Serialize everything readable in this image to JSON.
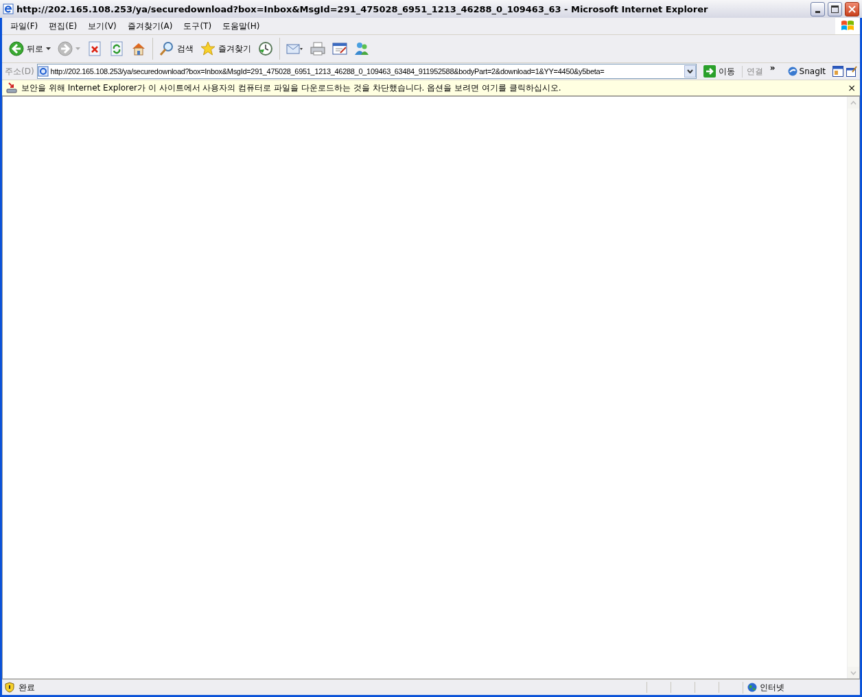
{
  "window": {
    "title": "http://202.165.108.253/ya/securedownload?box=Inbox&MsgId=291_475028_6951_1213_46288_0_109463_63 - Microsoft Internet Explorer"
  },
  "menu": [
    "파일(F)",
    "편집(E)",
    "보기(V)",
    "즐겨찾기(A)",
    "도구(T)",
    "도움말(H)"
  ],
  "toolbar": [
    {
      "kind": "back",
      "label": "뒤로",
      "disabled": false
    },
    {
      "kind": "forward",
      "disabled": true
    },
    {
      "kind": "stop"
    },
    {
      "kind": "refresh"
    },
    {
      "kind": "home"
    },
    {
      "kind": "sep"
    },
    {
      "kind": "search",
      "label": "검색"
    },
    {
      "kind": "favorites",
      "label": "즐겨찾기"
    },
    {
      "kind": "history"
    },
    {
      "kind": "sep"
    },
    {
      "kind": "mail"
    },
    {
      "kind": "print"
    },
    {
      "kind": "edit"
    },
    {
      "kind": "messenger"
    }
  ],
  "address": {
    "label": "주소(D)",
    "value": "http://202.165.108.253/ya/securedownload?box=Inbox&MsgId=291_475028_6951_1213_46288_0_109463_63484_911952588&bodyPart=2&download=1&YY=4450&y5beta=",
    "go": "이동",
    "links": "연결",
    "chevron": "»",
    "snagit": "SnagIt"
  },
  "info_bar": {
    "text": "보안을 위해 Internet Explorer가 이 사이트에서 사용자의 컴퓨터로 파일을 다운로드하는 것을 차단했습니다. 옵션을 보려면 여기를 클릭하십시오.",
    "close": "×"
  },
  "status_bar": {
    "text": "완료",
    "zone": "인터넷"
  }
}
